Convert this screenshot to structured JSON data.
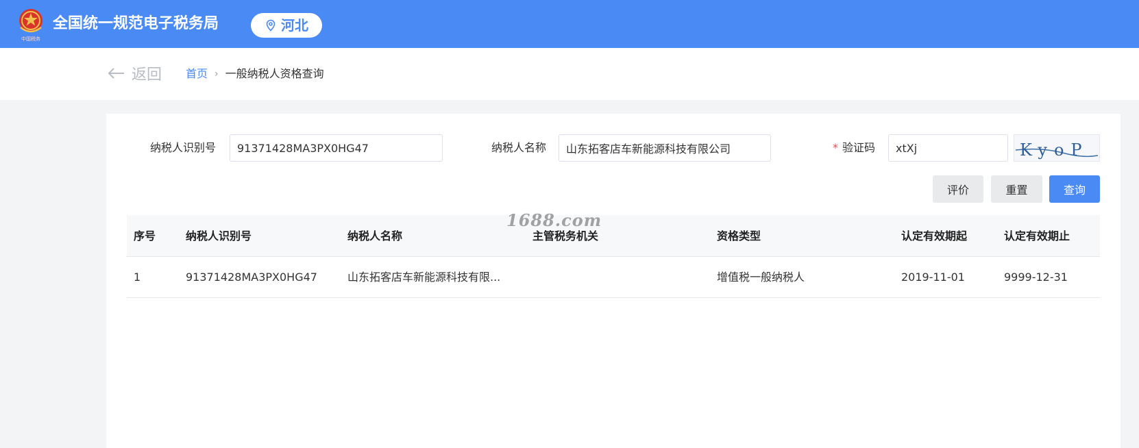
{
  "header": {
    "site_title": "全国统一规范电子税务局",
    "region": "河北",
    "emblem_text": "中国税务",
    "brand_color": "#4a8af4"
  },
  "nav": {
    "back_label": "返回",
    "breadcrumb": {
      "home": "首页",
      "separator": "›",
      "current": "一般纳税人资格查询"
    }
  },
  "search": {
    "taxpayer_id_label": "纳税人识别号",
    "taxpayer_id_value": "91371428MA3PX0HG47",
    "taxpayer_name_label": "纳税人名称",
    "taxpayer_name_value": "山东拓客店车新能源科技有限公司",
    "captcha_required_mark": "*",
    "captcha_label": "验证码",
    "captcha_value": "xtXj",
    "captcha_image_text": "KyoP"
  },
  "actions": {
    "evaluate": "评价",
    "reset": "重置",
    "query": "查询"
  },
  "table": {
    "columns": [
      "序号",
      "纳税人识别号",
      "纳税人名称",
      "主管税务机关",
      "资格类型",
      "认定有效期起",
      "认定有效期止"
    ],
    "rows": [
      [
        "1",
        "91371428MA3PX0HG47",
        "山东拓客店车新能源科技有限...",
        "",
        "增值税一般纳税人",
        "2019-11-01",
        "9999-12-31"
      ]
    ]
  },
  "watermark": "1688.com"
}
